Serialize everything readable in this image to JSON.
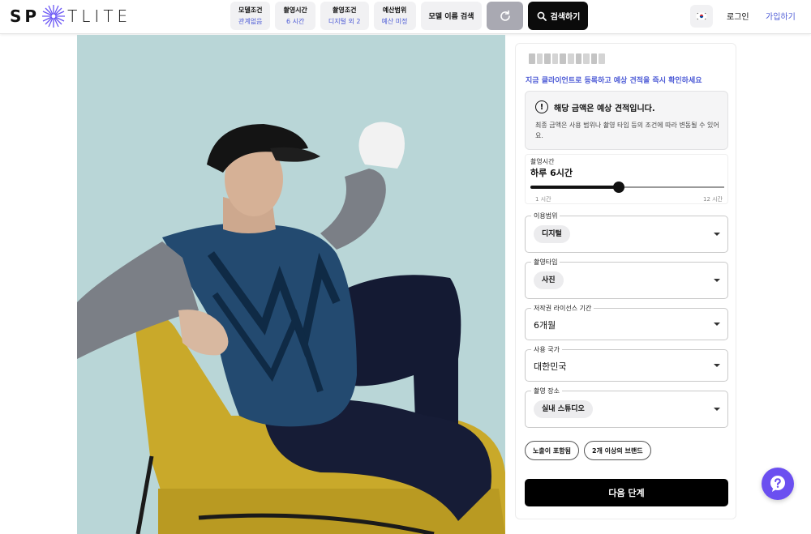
{
  "header": {
    "logo_left": "SP",
    "logo_right": "TLITE",
    "chips": [
      {
        "title": "모델조건",
        "sub": "관계없음"
      },
      {
        "title": "촬영시간",
        "sub": "6 시간"
      },
      {
        "title": "촬영조건",
        "sub": "디지털 외 2"
      },
      {
        "title": "예산범위",
        "sub": "예산 미정"
      }
    ],
    "name_search_label": "모델 이름 검색",
    "search_label": "검색하기",
    "flag_icon": "korea-flag-icon",
    "login_label": "로그인",
    "signup_label": "가입하기"
  },
  "panel": {
    "promo": "지금 클라이언트로 등록하고 예상 견적을 즉시 확인하세요",
    "notice_title": "해당 금액은 예상 견적입니다.",
    "notice_desc": "최종 금액은 사용 범위나 촬영 타입 등의 조건에 따라 변동될 수 있어요.",
    "slider": {
      "label": "촬영시간",
      "value_text": "하루 6시간",
      "min_label": "1 시간",
      "max_label": "12 시간",
      "min": 1,
      "max": 12,
      "value": 6
    },
    "fields": [
      {
        "legend": "이용범위",
        "value": "디지털"
      },
      {
        "legend": "촬영타입",
        "value": "사진"
      },
      {
        "legend": "저작권 라이선스 기간",
        "value": "6개월"
      },
      {
        "legend": "사용 국가",
        "value": "대한민국"
      },
      {
        "legend": "촬영 장소",
        "value": "실내 스튜디오"
      }
    ],
    "tags": [
      "노출이 포함됨",
      "2개 이상의 브랜드"
    ],
    "next_label": "다음 단계"
  },
  "colors": {
    "accent": "#4d5bd6",
    "help": "#6b4ff0",
    "chair": "#c9a92a"
  }
}
